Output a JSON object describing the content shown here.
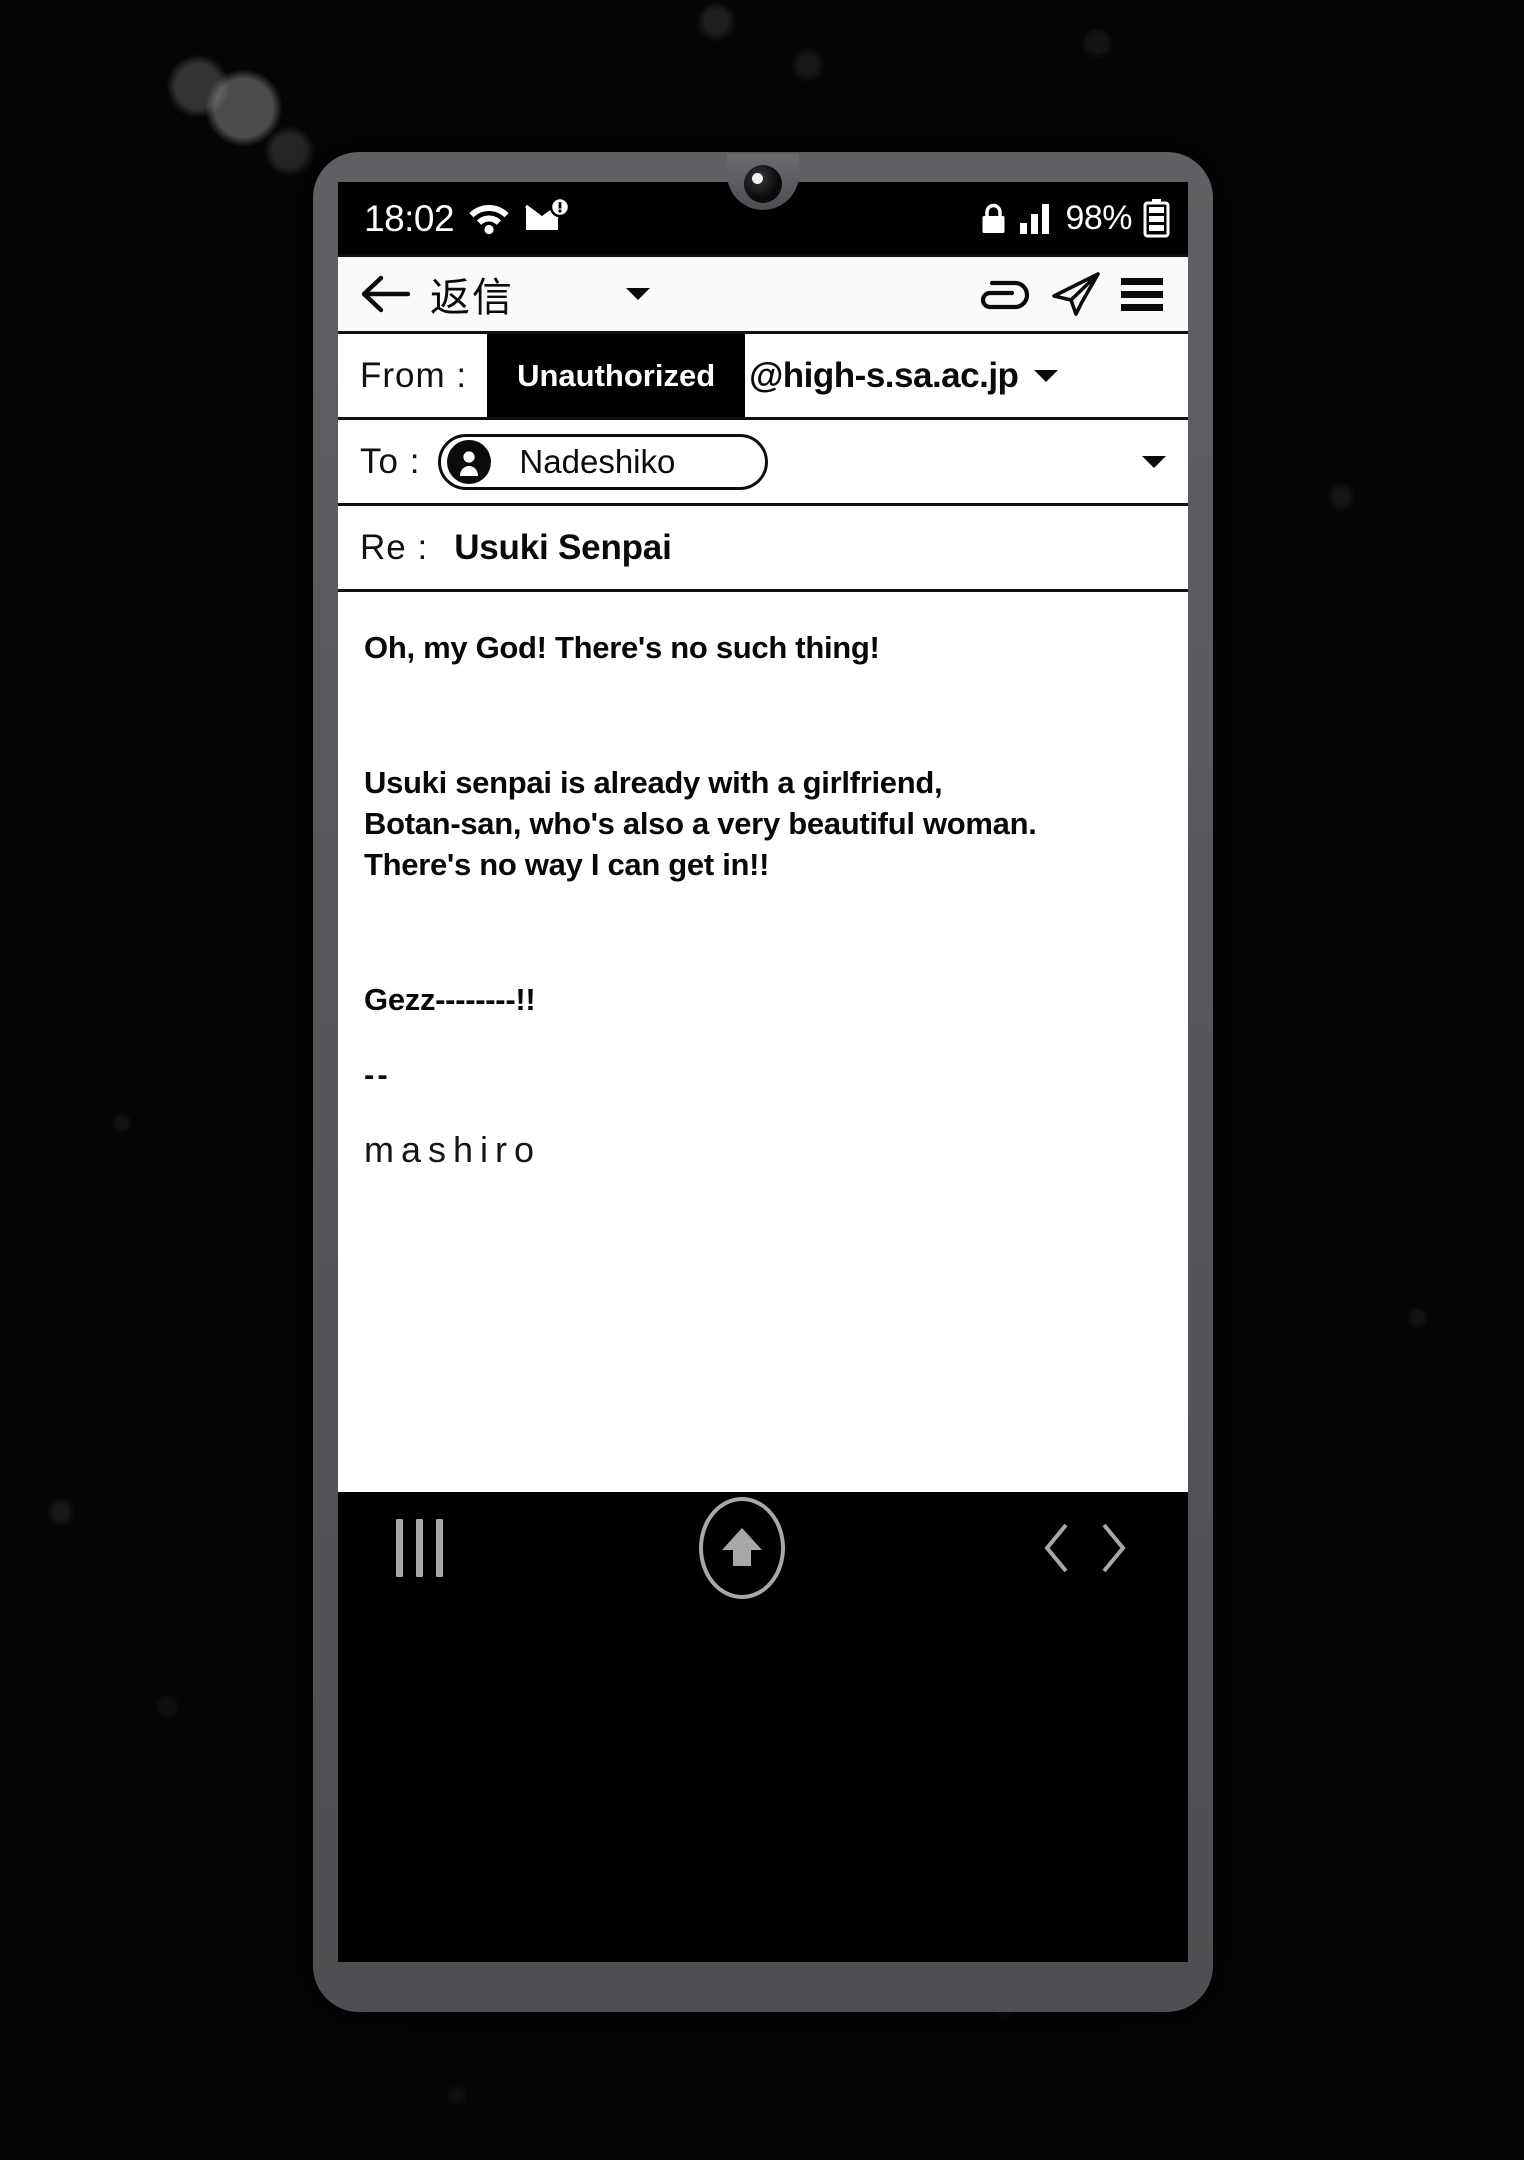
{
  "status_bar": {
    "time": "18:02",
    "wifi_icon": "wifi-icon",
    "mail_alert_icon": "mail-alert-icon",
    "lock_icon": "lock-icon",
    "signal_icon": "signal-bars-icon",
    "battery_percent": "98%",
    "battery_icon": "battery-icon"
  },
  "toolbar": {
    "back_icon": "back-arrow-icon",
    "title": "返信",
    "dropdown_icon": "chevron-down-icon",
    "attach_icon": "attachment-icon",
    "send_icon": "send-paper-plane-icon",
    "menu_icon": "hamburger-menu-icon"
  },
  "compose": {
    "from": {
      "label": "From :",
      "redacted_value": "Unauthorized",
      "domain": "@high-s.sa.ac.jp",
      "dropdown_icon": "chevron-down-icon"
    },
    "to": {
      "label": "To :",
      "recipient": "Nadeshiko",
      "avatar_icon": "person-avatar-icon",
      "dropdown_icon": "chevron-down-icon"
    },
    "subject": {
      "label": "Re :",
      "value": "Usuki Senpai"
    },
    "body": {
      "paragraph1": "Oh, my God! There's no such thing!",
      "paragraph2": "Usuki senpai is already with a girlfriend,\nBotan-san, who's also a very beautiful woman.\nThere's no way I can get in!!",
      "paragraph3": "Gezz--------!!",
      "signature_separator": "--",
      "signature_name": "mashiro"
    }
  },
  "nav_bar": {
    "recents_icon": "recents-bars-icon",
    "home_icon": "home-up-arrow-icon",
    "back_icon": "chevron-left-icon",
    "forward_icon": "chevron-right-icon"
  },
  "colors": {
    "screen_black": "#000000",
    "panel_white": "#ffffff",
    "border_black": "#101010",
    "frame_gray": "#54565a",
    "nav_icon_gray": "#a8a8a8"
  }
}
